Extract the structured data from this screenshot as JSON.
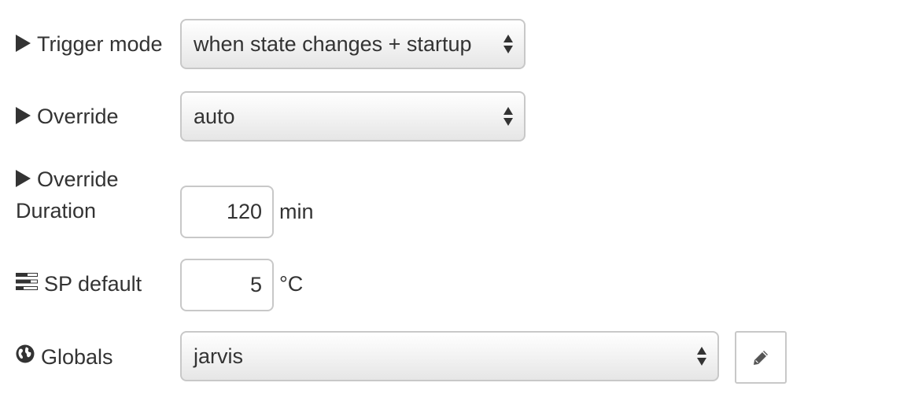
{
  "form": {
    "trigger_mode": {
      "label": "Trigger mode",
      "icon": "caret-right-icon",
      "value": "when state changes + startup"
    },
    "override": {
      "label": "Override",
      "icon": "caret-right-icon",
      "value": "auto"
    },
    "override_duration": {
      "label_line1": "Override",
      "label_line2": "Duration",
      "icon": "caret-right-icon",
      "value": "120",
      "unit": "min"
    },
    "sp_default": {
      "label": "SP default",
      "icon": "tasks-icon",
      "value": "5",
      "unit": "°C"
    },
    "globals": {
      "label": "Globals",
      "icon": "globe-icon",
      "value": "jarvis",
      "edit_icon": "pencil-icon"
    }
  },
  "colors": {
    "text": "#333333",
    "border": "#c8c8c8",
    "background": "#ffffff"
  }
}
